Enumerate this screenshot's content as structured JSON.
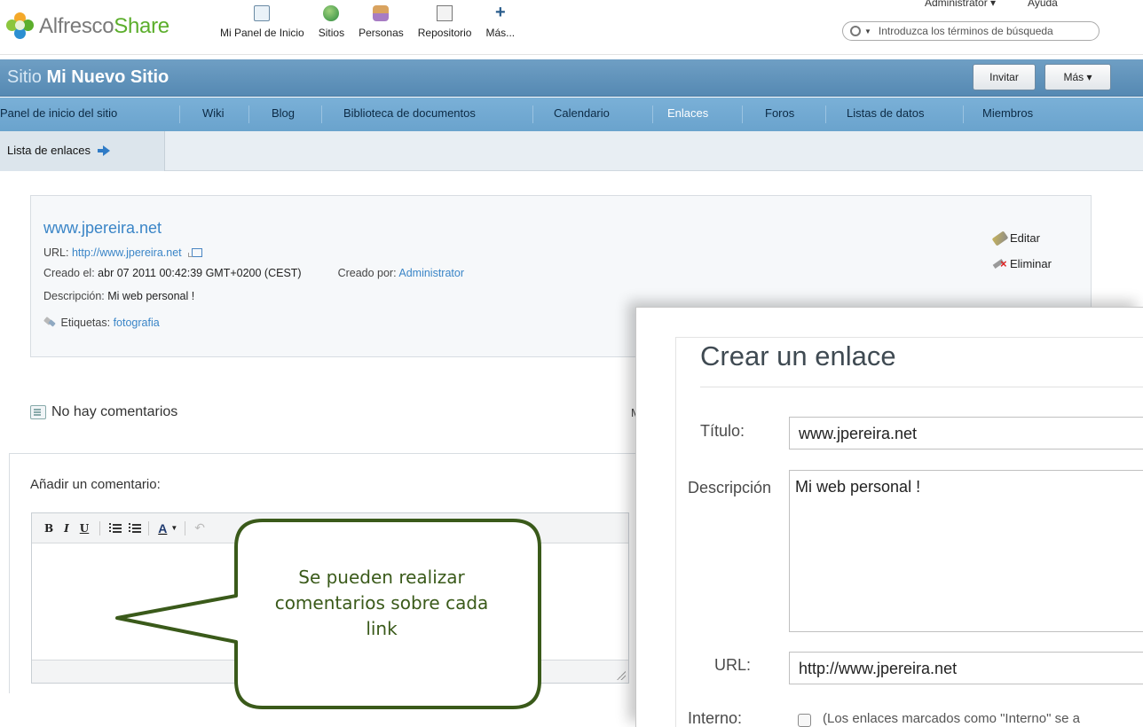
{
  "app": {
    "logo_primary": "Alfresco",
    "logo_secondary": "Share"
  },
  "appnav": [
    {
      "label": "Mi Panel de Inicio",
      "icon": "dashboard-icon"
    },
    {
      "label": "Sitios",
      "icon": "sites-icon"
    },
    {
      "label": "Personas",
      "icon": "people-icon"
    },
    {
      "label": "Repositorio",
      "icon": "repository-icon"
    },
    {
      "label": "Más...",
      "icon": "plus-icon"
    }
  ],
  "header": {
    "user_menu": "Administrator ▾",
    "help": "Ayuda",
    "search_placeholder": "Introduzca los términos de búsqueda"
  },
  "site": {
    "label": "Sitio",
    "name": "Mi Nuevo Sitio",
    "invite_button": "Invitar",
    "more_button": "Más ▾"
  },
  "tabs": [
    {
      "label": "Panel de inicio del sitio"
    },
    {
      "label": "Wiki"
    },
    {
      "label": "Blog"
    },
    {
      "label": "Biblioteca de documentos"
    },
    {
      "label": "Calendario"
    },
    {
      "label": "Enlaces",
      "active": true
    },
    {
      "label": "Foros"
    },
    {
      "label": "Listas de datos"
    },
    {
      "label": "Miembros"
    }
  ],
  "subnav": {
    "link_list": "Lista de enlaces"
  },
  "link": {
    "title": "www.jpereira.net",
    "url_label": "URL:",
    "url_value": "http://www.jpereira.net",
    "created_label": "Creado el:",
    "created_value": "abr 07 2011 00:42:39 GMT+0200 (CEST)",
    "created_by_label": "Creado por:",
    "created_by_value": "Administrator",
    "description_label": "Descripción:",
    "description_value": "Mi web personal !",
    "tags_label": "Etiquetas:",
    "tags_value": "fotografia",
    "edit": "Editar",
    "delete": "Eliminar"
  },
  "comments": {
    "none": "No hay comentarios",
    "partial_letter": "M",
    "add_label": "Añadir un comentario:",
    "toolbar": {
      "bold": "B",
      "italic": "I",
      "underline": "U",
      "font_color": "A"
    }
  },
  "callout": {
    "text": "Se pueden realizar comentarios sobre cada link",
    "fill": "#ffffff",
    "stroke": "#3a5a1a"
  },
  "dialog": {
    "title": "Crear un enlace",
    "title_label": "Título:",
    "title_value": "www.jpereira.net",
    "description_label": "Descripción",
    "description_value": "Mi web personal !",
    "url_label": "URL:",
    "url_value": "http://www.jpereira.net",
    "internal_label": "Interno:",
    "internal_hint": "(Los enlaces marcados como \"Interno\" se a"
  },
  "colors": {
    "site_bar": "#5f93bb",
    "tab_bar": "#72aad2",
    "link_blue": "#3a85c7",
    "share_green": "#5cae2c",
    "callout_green": "#3a5a1a"
  }
}
